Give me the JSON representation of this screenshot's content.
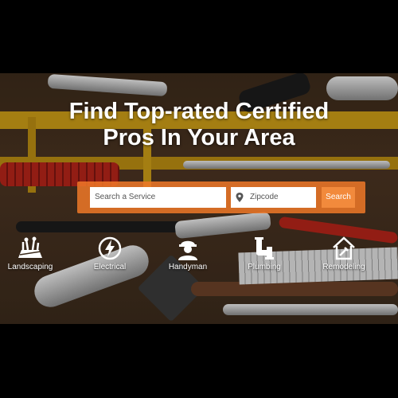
{
  "hero": {
    "title_line1": "Find Top-rated Certified",
    "title_line2": "Pros In Your Area"
  },
  "search": {
    "service_placeholder": "Search a Service",
    "zip_placeholder": "Zipcode",
    "button_label": "Search"
  },
  "categories": [
    {
      "label": "Landscaping",
      "icon": "landscaping-icon"
    },
    {
      "label": "Electrical",
      "icon": "electrical-icon"
    },
    {
      "label": "Handyman",
      "icon": "handyman-icon"
    },
    {
      "label": "Plumbing",
      "icon": "plumbing-icon"
    },
    {
      "label": "Remodeling",
      "icon": "remodeling-icon"
    }
  ],
  "colors": {
    "accent": "#f28a3c",
    "search_frame": "#f07828"
  }
}
